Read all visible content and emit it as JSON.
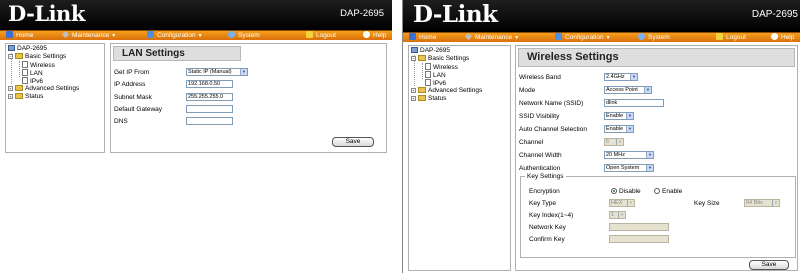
{
  "brand": {
    "logo": "D-Link",
    "model": "DAP-2695"
  },
  "menu": {
    "home": "Home",
    "maintenance": "Maintenance",
    "configuration": "Configuration",
    "system": "System",
    "logout": "Logout",
    "help": "Help"
  },
  "tree": {
    "root": "DAP-2695",
    "basic": "Basic Settings",
    "wireless": "Wireless",
    "lan": "LAN",
    "ipv6": "IPv6",
    "advanced": "Advanced Settings",
    "status": "Status"
  },
  "lan": {
    "title": "LAN Settings",
    "get_ip_label": "Get IP From",
    "get_ip_value": "Static IP (Manual)",
    "ip_label": "IP Address",
    "ip_value": "192.168.0.50",
    "mask_label": "Subnet Mask",
    "mask_value": "255.255.255.0",
    "gateway_label": "Default Gateway",
    "gateway_value": "",
    "dns_label": "DNS",
    "dns_value": "",
    "save": "Save"
  },
  "wireless": {
    "title": "Wireless Settings",
    "band_label": "Wireless Band",
    "band_value": "2.4GHz",
    "mode_label": "Mode",
    "mode_value": "Access Point",
    "ssid_label": "Network Name (SSID)",
    "ssid_value": "dlink",
    "visibility_label": "SSID Visibility",
    "visibility_value": "Enable",
    "autochan_label": "Auto Channel Selection",
    "autochan_value": "Enable",
    "channel_label": "Channel",
    "channel_value": "6",
    "width_label": "Channel Width",
    "width_value": "20 MHz",
    "auth_label": "Authentication",
    "auth_value": "Open System",
    "key_settings": "Key Settings",
    "encryption_label": "Encryption",
    "disable": "Disable",
    "enable": "Enable",
    "key_type_label": "Key Type",
    "key_type_value": "HEX",
    "key_size_label": "Key Size",
    "key_size_value": "64 Bits",
    "key_index_label": "Key Index(1~4)",
    "key_index_value": "1",
    "network_key_label": "Network Key",
    "network_key_value": "",
    "confirm_key_label": "Confirm Key",
    "confirm_key_value": "",
    "save": "Save"
  }
}
